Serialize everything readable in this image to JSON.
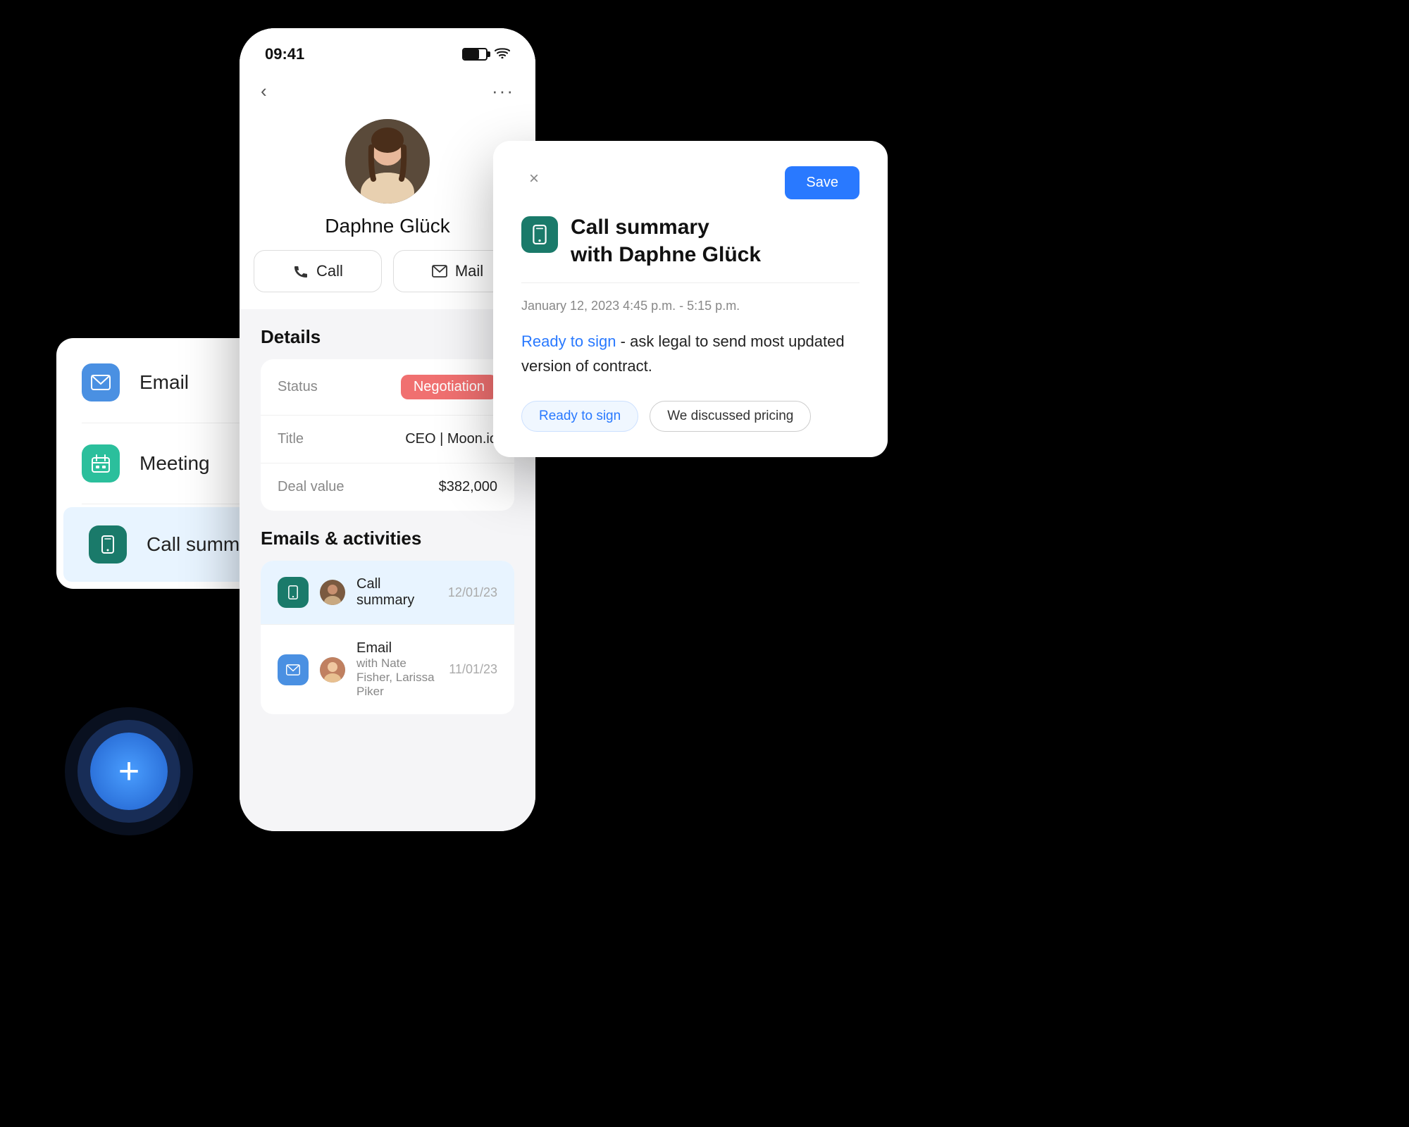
{
  "sidebar": {
    "items": [
      {
        "id": "email",
        "label": "Email",
        "icon": "email-icon",
        "iconBg": "blue",
        "active": false
      },
      {
        "id": "meeting",
        "label": "Meeting",
        "icon": "meeting-icon",
        "iconBg": "teal",
        "active": false
      },
      {
        "id": "call-summary",
        "label": "Call summary",
        "icon": "phone-icon",
        "iconBg": "dark-teal",
        "active": true
      }
    ]
  },
  "add_button": {
    "label": "+"
  },
  "phone": {
    "status_bar": {
      "time": "09:41",
      "battery": "70",
      "wifi": "wifi"
    },
    "nav": {
      "back": "‹",
      "more": "···"
    },
    "contact": {
      "name": "Daphne Glück"
    },
    "actions": [
      {
        "id": "call",
        "label": "Call"
      },
      {
        "id": "mail",
        "label": "Mail"
      }
    ],
    "details_title": "Details",
    "details": [
      {
        "label": "Status",
        "value": "Negotiation",
        "type": "badge"
      },
      {
        "label": "Title",
        "value": "CEO | Moon.io"
      },
      {
        "label": "Deal value",
        "value": "$382,000"
      }
    ],
    "activities_title": "Emails & activities",
    "activities": [
      {
        "id": "call-sum",
        "icon": "phone-icon",
        "iconBg": "dark-teal",
        "title": "Call summary",
        "date": "12/01/23"
      },
      {
        "id": "email-act",
        "icon": "email-icon",
        "iconBg": "blue",
        "title": "Email",
        "subtitle": "with Nate Fisher, Larissa Piker",
        "date": "11/01/23"
      }
    ]
  },
  "modal": {
    "title": "Call summary\nwith Daphne Glück",
    "title_line1": "Call summary",
    "title_line2": "with Daphne Glück",
    "datetime": "January 12, 2023  4:45 p.m. - 5:15 p.m.",
    "body_highlight": "Ready to sign",
    "body_rest": " - ask legal to send most updated version of contract.",
    "tags": [
      {
        "id": "ready-to-sign",
        "label": "Ready to sign"
      },
      {
        "id": "we-discussed-pricing",
        "label": "We discussed pricing"
      }
    ],
    "save_label": "Save",
    "close_label": "×"
  }
}
